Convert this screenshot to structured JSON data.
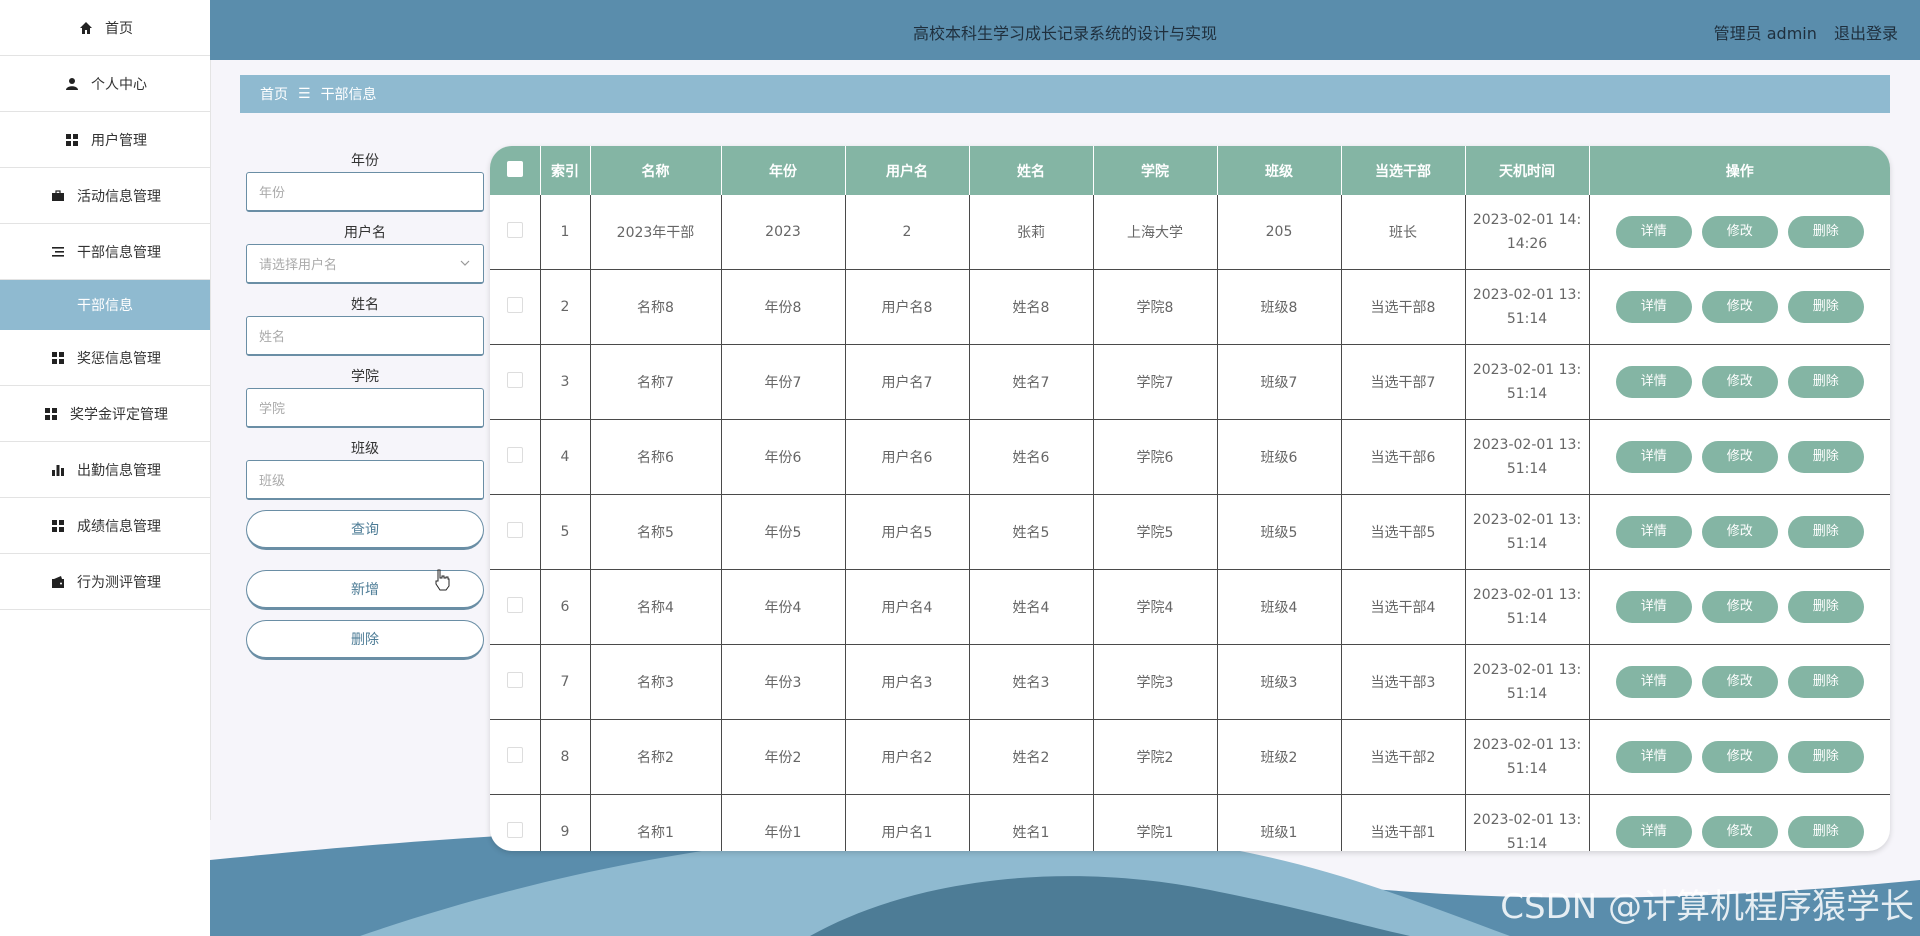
{
  "header": {
    "title": "高校本科生学习成长记录系统的设计与实现",
    "user": "管理员 admin",
    "logout": "退出登录"
  },
  "sidebar": {
    "items": [
      {
        "label": "首页",
        "icon": "home-icon"
      },
      {
        "label": "个人中心",
        "icon": "person-icon"
      },
      {
        "label": "用户管理",
        "icon": "grid-icon"
      },
      {
        "label": "活动信息管理",
        "icon": "briefcase-icon"
      },
      {
        "label": "干部信息管理",
        "icon": "list-icon"
      },
      {
        "label": "干部信息",
        "icon": ""
      },
      {
        "label": "奖惩信息管理",
        "icon": "grid-icon"
      },
      {
        "label": "奖学金评定管理",
        "icon": "grid-icon"
      },
      {
        "label": "出勤信息管理",
        "icon": "bar-chart-icon"
      },
      {
        "label": "成绩信息管理",
        "icon": "grid-icon"
      },
      {
        "label": "行为测评管理",
        "icon": "wallet-icon"
      }
    ],
    "active_index": 5
  },
  "breadcrumb": {
    "home": "首页",
    "sep": "☰",
    "current": "干部信息"
  },
  "search": {
    "year_label": "年份",
    "year_placeholder": "年份",
    "username_label": "用户名",
    "username_placeholder": "请选择用户名",
    "name_label": "姓名",
    "name_placeholder": "姓名",
    "college_label": "学院",
    "college_placeholder": "学院",
    "class_label": "班级",
    "class_placeholder": "班级",
    "query_button": "查询",
    "add_button": "新增",
    "delete_button": "删除"
  },
  "table": {
    "headers": [
      "索引",
      "名称",
      "年份",
      "用户名",
      "姓名",
      "学院",
      "班级",
      "当选干部",
      "天机时间",
      "操作"
    ],
    "actions": {
      "detail": "详情",
      "edit": "修改",
      "delete": "删除"
    },
    "rows": [
      {
        "index": "1",
        "name": "2023年干部",
        "year": "2023",
        "username": "2",
        "person": "张莉",
        "college": "上海大学",
        "class": "205",
        "cadre": "班长",
        "time1": "2023-02-01 14:",
        "time2": "14:26"
      },
      {
        "index": "2",
        "name": "名称8",
        "year": "年份8",
        "username": "用户名8",
        "person": "姓名8",
        "college": "学院8",
        "class": "班级8",
        "cadre": "当选干部8",
        "time1": "2023-02-01 13:",
        "time2": "51:14"
      },
      {
        "index": "3",
        "name": "名称7",
        "year": "年份7",
        "username": "用户名7",
        "person": "姓名7",
        "college": "学院7",
        "class": "班级7",
        "cadre": "当选干部7",
        "time1": "2023-02-01 13:",
        "time2": "51:14"
      },
      {
        "index": "4",
        "name": "名称6",
        "year": "年份6",
        "username": "用户名6",
        "person": "姓名6",
        "college": "学院6",
        "class": "班级6",
        "cadre": "当选干部6",
        "time1": "2023-02-01 13:",
        "time2": "51:14"
      },
      {
        "index": "5",
        "name": "名称5",
        "year": "年份5",
        "username": "用户名5",
        "person": "姓名5",
        "college": "学院5",
        "class": "班级5",
        "cadre": "当选干部5",
        "time1": "2023-02-01 13:",
        "time2": "51:14"
      },
      {
        "index": "6",
        "name": "名称4",
        "year": "年份4",
        "username": "用户名4",
        "person": "姓名4",
        "college": "学院4",
        "class": "班级4",
        "cadre": "当选干部4",
        "time1": "2023-02-01 13:",
        "time2": "51:14"
      },
      {
        "index": "7",
        "name": "名称3",
        "year": "年份3",
        "username": "用户名3",
        "person": "姓名3",
        "college": "学院3",
        "class": "班级3",
        "cadre": "当选干部3",
        "time1": "2023-02-01 13:",
        "time2": "51:14"
      },
      {
        "index": "8",
        "name": "名称2",
        "year": "年份2",
        "username": "用户名2",
        "person": "姓名2",
        "college": "学院2",
        "class": "班级2",
        "cadre": "当选干部2",
        "time1": "2023-02-01 13:",
        "time2": "51:14"
      },
      {
        "index": "9",
        "name": "名称1",
        "year": "年份1",
        "username": "用户名1",
        "person": "姓名1",
        "college": "学院1",
        "class": "班级1",
        "cadre": "当选干部1",
        "time1": "2023-02-01 13:",
        "time2": "51:14"
      }
    ]
  },
  "watermark": "CSDN @计算机程序猿学长",
  "colors": {
    "primary": "#5a8dac",
    "accent": "#8fbad0",
    "table_header": "#84b5a4"
  }
}
